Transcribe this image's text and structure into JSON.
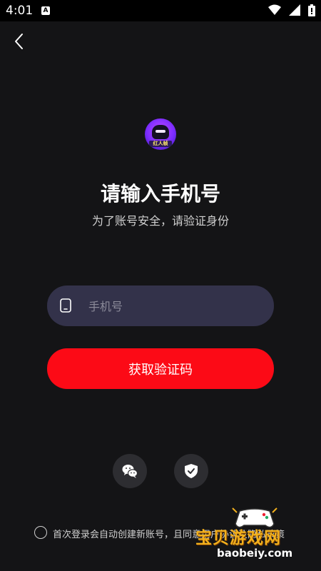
{
  "status_bar": {
    "time": "4:01",
    "badge": "A"
  },
  "main": {
    "title": "请输入手机号",
    "subtitle": "为了账号安全，请验证身份",
    "phone_placeholder": "手机号",
    "phone_value": "",
    "get_code_label": "获取验证码",
    "logo_label": "红人帧"
  },
  "agreement": {
    "text": "首次登录会自动创建新账号，且同意用户协议及隐私政策"
  },
  "watermark": {
    "title": "宝贝游戏网",
    "url": "baobeiy.com"
  },
  "colors": {
    "background": "#141416",
    "accent": "#fc0a16",
    "input_bg": "#33324a"
  },
  "icons": {
    "back": "chevron-left-icon",
    "phone": "phone-icon",
    "wechat": "wechat-icon",
    "shield": "shield-check-icon"
  }
}
